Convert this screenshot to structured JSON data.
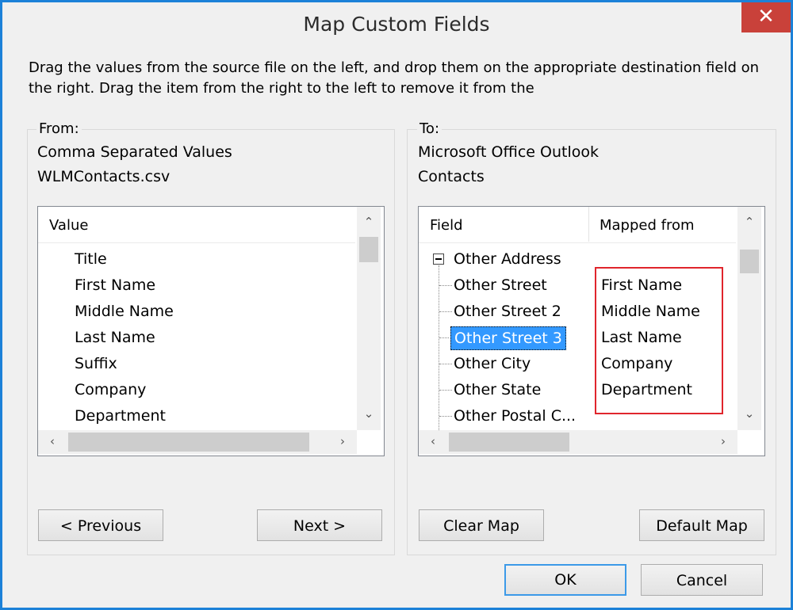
{
  "window": {
    "title": "Map Custom Fields",
    "close_glyph": "✕",
    "instructions": "Drag the values from the source file on the left, and drop them on the appropriate destination field on the right.  Drag the item from the right to the left to remove it from the"
  },
  "from": {
    "label": "From:",
    "source_type": "Comma Separated Values",
    "file_name": "WLMContacts.csv",
    "column_header": "Value",
    "items": [
      "Title",
      "First Name",
      "Middle Name",
      "Last Name",
      "Suffix",
      "Company",
      "Department"
    ],
    "previous_label": "< Previous",
    "next_label": "Next >"
  },
  "to": {
    "label": "To:",
    "target_app": "Microsoft Office Outlook",
    "target_folder": "Contacts",
    "field_header": "Field",
    "mapped_header": "Mapped from",
    "group_label": "Other Address",
    "rows": [
      {
        "field": "Other Street",
        "mapped": "First Name"
      },
      {
        "field": "Other Street 2",
        "mapped": "Middle Name"
      },
      {
        "field": "Other Street 3",
        "mapped": "Last Name"
      },
      {
        "field": "Other City",
        "mapped": "Company"
      },
      {
        "field": "Other State",
        "mapped": "Department"
      },
      {
        "field": "Other Postal C...",
        "mapped": ""
      }
    ],
    "selected_row": "Other Street 3",
    "clear_map_label": "Clear Map",
    "default_map_label": "Default Map"
  },
  "footer": {
    "ok_label": "OK",
    "cancel_label": "Cancel"
  },
  "icons": {
    "scroll_up": "chevron-up-icon",
    "scroll_down": "chevron-down-icon",
    "scroll_left": "chevron-left-icon",
    "scroll_right": "chevron-right-icon",
    "collapse": "minus-box-icon"
  },
  "colors": {
    "window_border": "#1c81d8",
    "close_button": "#c9413a",
    "selection": "#3399ff",
    "highlight_box": "#e0252c"
  }
}
